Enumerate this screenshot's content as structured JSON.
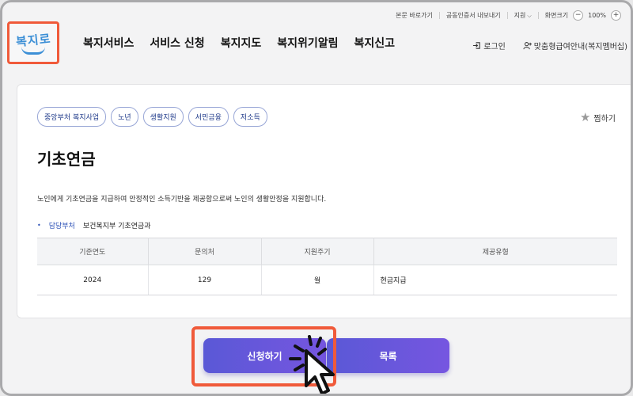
{
  "utility": {
    "skip_link": "본문 바로가기",
    "cert_export": "공동인증서 내보내기",
    "support": "지원",
    "zoom_label": "화면크기",
    "zoom_out": "−",
    "zoom_value": "100%",
    "zoom_in": "+"
  },
  "logo": {
    "text": "복지로"
  },
  "nav": {
    "items": [
      "복지서비스",
      "서비스 신청",
      "복지지도",
      "복지위기알림",
      "복지신고"
    ]
  },
  "header_right": {
    "login": "로그인",
    "guide": "맞춤형급여안내(복지멤버십)"
  },
  "detail": {
    "tags": [
      "중앙부처 복지사업",
      "노년",
      "생활지원",
      "서민금융",
      "저소득"
    ],
    "favorite": "찜하기",
    "title": "기초연금",
    "description": "노인에게 기초연금을 지급하여 안정적인 소득기반을 제공함으로써 노인의 생활안정을 지원합니다.",
    "dept_label": "담당부처",
    "dept_value": "보건복지부 기초연금과",
    "table": {
      "headers": [
        "기준연도",
        "문의처",
        "지원주기",
        "제공유형"
      ],
      "row": [
        "2024",
        "129",
        "월",
        "현금지급"
      ]
    }
  },
  "actions": {
    "apply": "신청하기",
    "list": "목록"
  },
  "colors": {
    "highlight": "#f05a3a",
    "button": "#5a58d6",
    "tag_text": "#1f3a8a"
  }
}
